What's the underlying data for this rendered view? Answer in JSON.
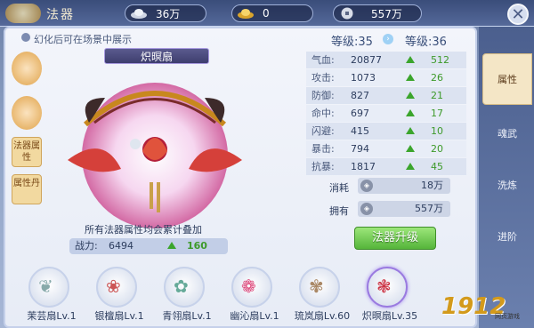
{
  "header": {
    "title": "法器",
    "currencies": [
      {
        "icon": "silver-ingot-icon",
        "value": "36万"
      },
      {
        "icon": "gold-ingot-icon",
        "value": "0"
      },
      {
        "icon": "coin-icon",
        "value": "557万"
      }
    ]
  },
  "left_tabs": [
    {
      "label": "",
      "icon": "fan-illusion-icon"
    },
    {
      "label": "",
      "icon": "fan-book-icon"
    },
    {
      "label": "法器属性"
    },
    {
      "label": "属性丹"
    }
  ],
  "preview": {
    "hint": "幻化后可在场景中展示",
    "item_name": "炽暝扇",
    "stack_note": "所有法器属性均会累计叠加",
    "power_label": "战力:",
    "power_value": "6494",
    "power_gain": "160"
  },
  "level": {
    "current": "等级:35",
    "next": "等级:36"
  },
  "stats": [
    {
      "name": "气血:",
      "value": "20877",
      "gain": "512"
    },
    {
      "name": "攻击:",
      "value": "1073",
      "gain": "26"
    },
    {
      "name": "防御:",
      "value": "827",
      "gain": "21"
    },
    {
      "name": "命中:",
      "value": "697",
      "gain": "17"
    },
    {
      "name": "闪避:",
      "value": "415",
      "gain": "10"
    },
    {
      "name": "暴击:",
      "value": "794",
      "gain": "20"
    },
    {
      "name": "抗暴:",
      "value": "1817",
      "gain": "45"
    }
  ],
  "cost": {
    "consume_label": "消耗",
    "consume_value": "18万",
    "own_label": "拥有",
    "own_value": "557万"
  },
  "upgrade_button": "法器升级",
  "right_tabs": [
    "属性",
    "魂武",
    "洗炼",
    "进阶"
  ],
  "fans": [
    {
      "name": "茉芸扇Lv.1",
      "selected": false
    },
    {
      "name": "银檀扇Lv.1",
      "selected": false
    },
    {
      "name": "青翎扇Lv.1",
      "selected": false
    },
    {
      "name": "幽沁扇Lv.1",
      "selected": false
    },
    {
      "name": "琉岚扇Lv.60",
      "selected": false
    },
    {
      "name": "炽暝扇Lv.35",
      "selected": true
    }
  ],
  "watermark": {
    "brand": "1912",
    "sub": "网页游戏"
  },
  "colors": {
    "accent_green": "#3ba52c",
    "tab_active": "#f4e6c6",
    "header": "#3a4d7a"
  }
}
